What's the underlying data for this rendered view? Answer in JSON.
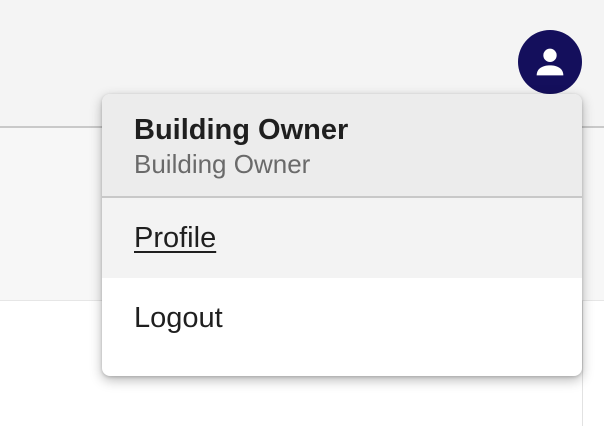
{
  "colors": {
    "accent": "#140f5c"
  },
  "header": {
    "avatar_icon": "person-icon"
  },
  "user_menu": {
    "name": "Building Owner",
    "role": "Building Owner",
    "items": [
      {
        "label": "Profile",
        "hovered": true
      },
      {
        "label": "Logout",
        "hovered": false
      }
    ]
  }
}
